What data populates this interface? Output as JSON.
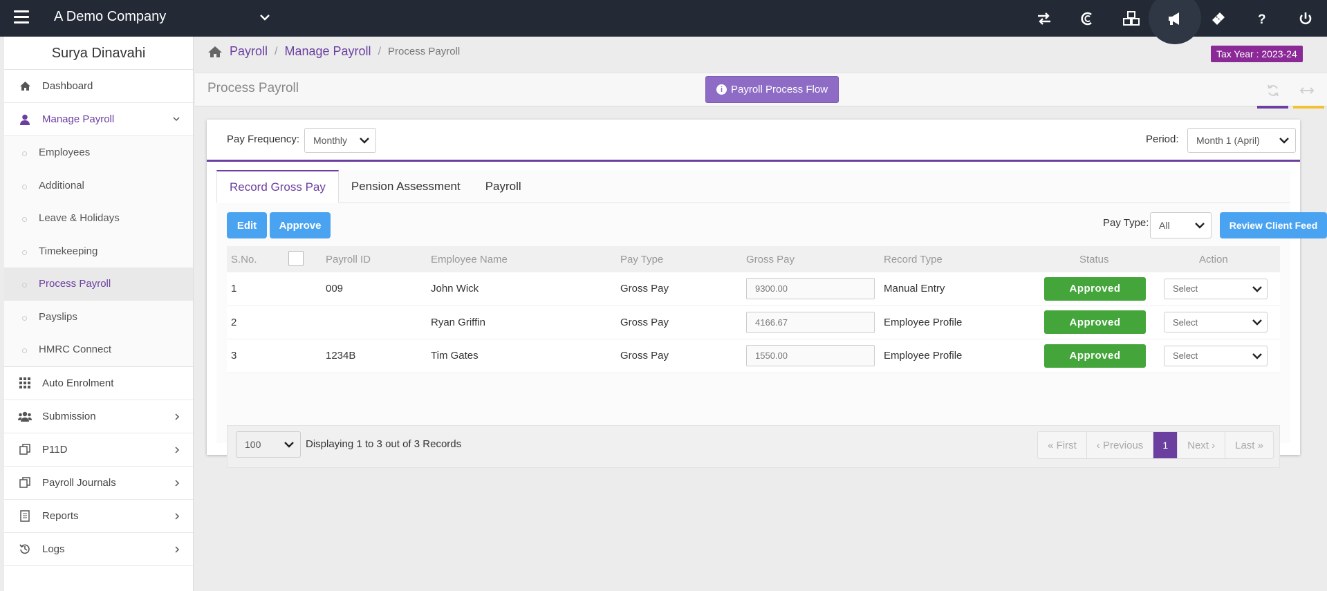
{
  "topbar": {
    "company": "A Demo Company",
    "icons": [
      "switch-icon",
      "credit-icon",
      "cubes-icon",
      "megaphone-icon",
      "ticket-icon",
      "help-icon",
      "power-icon"
    ]
  },
  "sidebar": {
    "user": "Surya Dinavahi",
    "dashboard": "Dashboard",
    "manage_payroll": "Manage Payroll",
    "sub_items": [
      "Employees",
      "Additional",
      "Leave & Holidays",
      "Timekeeping",
      "Process Payroll",
      "Payslips",
      "HMRC Connect"
    ],
    "active_sub": "Process Payroll",
    "auto_enrolment": "Auto Enrolment",
    "submission": "Submission",
    "p11d": "P11D",
    "payroll_journals": "Payroll Journals",
    "reports": "Reports",
    "logs": "Logs"
  },
  "breadcrumb": {
    "item1": "Payroll",
    "item2": "Manage Payroll",
    "current": "Process Payroll",
    "sep": "/"
  },
  "tax_year": "Tax Year : 2023-24",
  "page": {
    "title": "Process Payroll",
    "flow_button": "Payroll Process Flow",
    "accent_colors": [
      "#6b3fa0",
      "#f2c230"
    ]
  },
  "filters": {
    "pay_frequency_label": "Pay Frequency:",
    "pay_frequency_value": "Monthly",
    "period_label": "Period:",
    "period_value": "Month 1 (April)"
  },
  "tabs": [
    "Record Gross Pay",
    "Pension Assessment",
    "Payroll"
  ],
  "toolbar": {
    "edit": "Edit",
    "approve": "Approve",
    "pay_type_label": "Pay Type:",
    "pay_type_value": "All",
    "review_button": "Review Client Feed"
  },
  "table": {
    "headers": [
      "S.No.",
      "Payroll ID",
      "Employee Name",
      "Pay Type",
      "Gross Pay",
      "Record Type",
      "Status",
      "Action"
    ],
    "rows": [
      {
        "sno": "1",
        "payroll_id": "009",
        "name": "John Wick",
        "pay_type": "Gross Pay",
        "gross": "9300.00",
        "record_type": "Manual Entry",
        "status": "Approved",
        "action": "Select"
      },
      {
        "sno": "2",
        "payroll_id": "",
        "name": "Ryan Griffin",
        "pay_type": "Gross Pay",
        "gross": "4166.67",
        "record_type": "Employee Profile",
        "status": "Approved",
        "action": "Select"
      },
      {
        "sno": "3",
        "payroll_id": "1234B",
        "name": "Tim Gates",
        "pay_type": "Gross Pay",
        "gross": "1550.00",
        "record_type": "Employee Profile",
        "status": "Approved",
        "action": "Select"
      }
    ]
  },
  "footer": {
    "page_size": "100",
    "records_text": "Displaying 1 to 3 out of 3 Records",
    "pager": {
      "first": "« First",
      "previous": "‹ Previous",
      "current": "1",
      "next": "Next ›",
      "last": "Last »"
    }
  }
}
